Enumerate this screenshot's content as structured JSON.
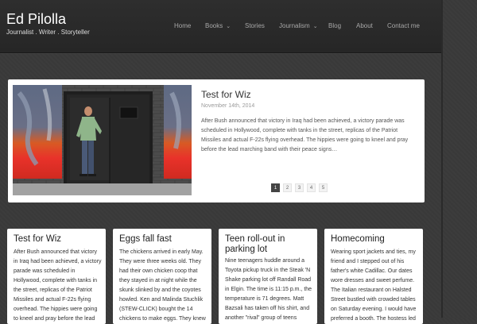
{
  "site": {
    "title": "Ed Pilolla",
    "tagline": "Journalist . Writer . Storyteller"
  },
  "nav": {
    "items": [
      {
        "label": "Home",
        "dropdown": false
      },
      {
        "label": "Books",
        "dropdown": true
      },
      {
        "label": "Stories",
        "dropdown": false
      },
      {
        "label": "Journalism",
        "dropdown": true
      },
      {
        "label": "Blog",
        "dropdown": false
      },
      {
        "label": "About",
        "dropdown": false
      },
      {
        "label": "Contact me",
        "dropdown": false
      }
    ]
  },
  "featured": {
    "title": "Test for Wiz",
    "date": "November 14th, 2014",
    "excerpt": "After Bush announced that victory in Iraq had been achieved, a victory parade was scheduled in Hollywood, complete with tanks in the street, replicas of the Patriot Missiles and actual F-22s flying overhead. The hippies were going to kneel and pray before the lead marching band with their peace signs…",
    "pages": [
      "1",
      "2",
      "3",
      "4",
      "5"
    ],
    "active_page": "1"
  },
  "posts": [
    {
      "title": "Test for Wiz",
      "excerpt": "After Bush announced that victory in Iraq had been achieved, a victory parade was scheduled in Hollywood, complete with tanks in the street, replicas of the Patriot Missiles and actual F-22s flying overhead. The hippies were going to kneel and pray before the lead"
    },
    {
      "title": "Eggs fall fast",
      "excerpt": "The chickens arrived in early May. They were three weeks old. They had their own chicken coop that they stayed in at night while the skunk slinked by and the coyotes howled. Ken and Malinda Stuchlik (STEW-CLICK) bought the 14 chickens to make eggs. They knew"
    },
    {
      "title": "Teen roll-out in parking lot",
      "excerpt": "Nine teenagers huddle around a Toyota pickup truck in the Steak 'N Shake parking lot off Randall Road in Elgin. The time is 11:15 p.m., the temperature is 71 degrees. Matt Bazsali has taken off his shirt, and another \"rival\" group of teens"
    },
    {
      "title": "Homecoming",
      "excerpt": "Wearing sport jackets and ties, my friend and I stepped out of his father's white Cadillac. Our dates wore dresses and sweet perfume. The Italian restaurant on Halsted Street bustled with crowded tables on Saturday evening. I would have preferred a booth. The hostess led"
    }
  ]
}
